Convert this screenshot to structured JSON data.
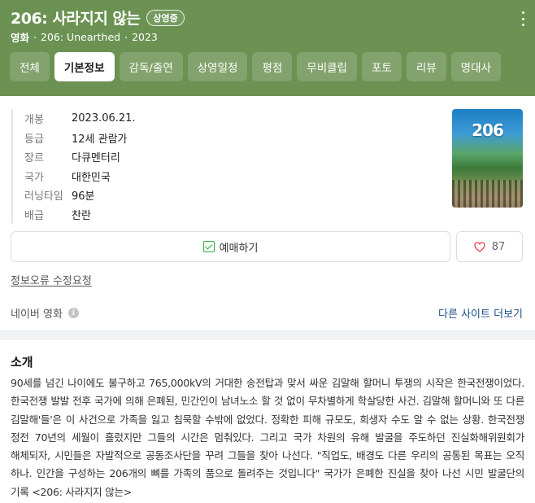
{
  "header": {
    "title": "206: 사라지지 않는",
    "status_badge": "상영중",
    "category": "영화",
    "english_title": "206: Unearthed",
    "year": "2023",
    "tabs": [
      {
        "label": "전체"
      },
      {
        "label": "기본정보"
      },
      {
        "label": "감독/출연"
      },
      {
        "label": "상영일정"
      },
      {
        "label": "평점"
      },
      {
        "label": "무비클립"
      },
      {
        "label": "포토"
      },
      {
        "label": "리뷰"
      },
      {
        "label": "명대사"
      }
    ],
    "active_tab": "기본정보"
  },
  "info": {
    "rows": [
      {
        "key": "개봉",
        "value": "2023.06.21."
      },
      {
        "key": "등급",
        "value": "12세 관람가"
      },
      {
        "key": "장르",
        "value": "다큐멘터리"
      },
      {
        "key": "국가",
        "value": "대한민국"
      },
      {
        "key": "러닝타임",
        "value": "96분"
      },
      {
        "key": "배급",
        "value": "찬란"
      }
    ],
    "poster_title": "206",
    "reserve_label": "예매하기",
    "like_count": "87",
    "report_link": "정보오류 수정요청",
    "source_label": "네이버 영화",
    "more_sites_label": "다른 사이트 더보기"
  },
  "synopsis": {
    "title": "소개",
    "text": "90세를 넘긴 나이에도 불구하고 765,000kV의 거대한 송전탑과 맞서 싸운 김말해 할머니 투쟁의 시작은 한국전쟁이었다. 한국전쟁 발발 전후 국가에 의해 은폐된, 민간인이 남녀노소 할 것 없이 무차별하게 학살당한 사건. 김말해 할머니와 또 다른 김말해'들'은 이 사건으로 가족을 잃고 침묵할 수밖에 없었다. 정확한 피해 규모도, 희생자 수도 알 수 없는 상황. 한국전쟁 정전 70년의 세월이 흘렀지만 그들의 시간은 멈춰있다. 그리고 국가 차원의 유해 발굴을 주도하던 진실화해위원회가 해체되자, 시민들은 자발적으로 공동조사단을 꾸려 그들을 찾아 나선다. \"직업도, 배경도 다른 우리의 공통된 목표는 오직 하나. 인간을 구성하는 206개의 뼈를 가족의 품으로 돌려주는 것입니다\" 국가가 은폐한 진실을 찾아 나선 시민 발굴단의 기록 <206: 사라지지 않는>"
  },
  "colors": {
    "header_bg": "#6b9252",
    "link_blue": "#1c4f8c",
    "check_green": "#2cad3c",
    "heart_red": "#e8424f"
  }
}
